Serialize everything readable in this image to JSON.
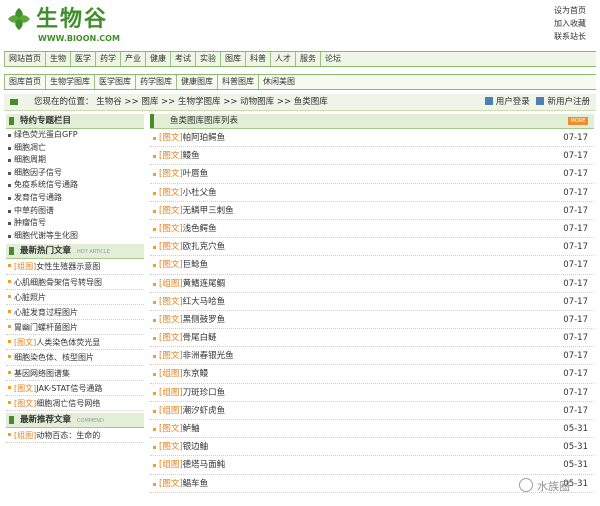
{
  "header": {
    "logo_name": "生物谷",
    "logo_domain": "WWW.BIOON.COM",
    "links": [
      "设为首页",
      "加入收藏",
      "联系站长"
    ]
  },
  "nav_main": [
    "网站首页",
    "生物",
    "医学",
    "药学",
    "产业",
    "健康",
    "考试",
    "实验",
    "图库",
    "科普",
    "人才",
    "服务",
    "论坛"
  ],
  "nav_sub": [
    "图库首页",
    "生物学图库",
    "医学图库",
    "药学图库",
    "健康图库",
    "科普图库",
    "休闲美图"
  ],
  "breadcrumb": {
    "path": "您现在的位置： 生物谷 >> 图库 >> 生物学图库 >> 动物图库 >> 鱼类图库",
    "login": "用户登录",
    "register": "新用户注册"
  },
  "left": {
    "section1": {
      "title": "特约专题栏目",
      "items": [
        "绿色荧光蛋白GFP",
        "细胞凋亡",
        "细胞周期",
        "细胞因子信号",
        "免疫系统信号通路",
        "发育信号通路",
        "中草药图谱",
        "肿瘤信号",
        "细胞代谢等生化图"
      ]
    },
    "section2": {
      "title": "最新热门文章",
      "sub": "HOT ARTICLE",
      "items": [
        {
          "tag": "[组图]",
          "text": "女性生殖器示意图"
        },
        {
          "tag": "",
          "text": "心肌细胞骨架信号转导图"
        },
        {
          "tag": "",
          "text": "心脏照片"
        },
        {
          "tag": "",
          "text": "心脏发育过程图片"
        },
        {
          "tag": "",
          "text": "胃幽门螺杆菌图片"
        },
        {
          "tag": "[图文]",
          "text": "人类染色体荧光显"
        },
        {
          "tag": "",
          "text": "细胞染色体、核型图片"
        },
        {
          "tag": "",
          "text": "基因网络图谱集"
        },
        {
          "tag": "[图文]",
          "text": "JAK-STAT信号通路"
        },
        {
          "tag": "[图文]",
          "text": "细胞凋亡信号网络"
        }
      ]
    },
    "section3": {
      "title": "最新推荐文章",
      "sub": "COMMEND",
      "items": [
        {
          "tag": "[组图]",
          "text": "动物百态：生命的"
        }
      ]
    }
  },
  "right": {
    "title": "鱼类图库图库列表",
    "more_label": "MORE",
    "rows": [
      {
        "tag": "[图文]",
        "title": "帕阿珀鳄鱼",
        "date": "07-17"
      },
      {
        "tag": "[图文]",
        "title": "鳗鱼",
        "date": "07-17"
      },
      {
        "tag": "[图文]",
        "title": "叶唇鱼",
        "date": "07-17"
      },
      {
        "tag": "[图文]",
        "title": "小杜父鱼",
        "date": "07-17"
      },
      {
        "tag": "[图文]",
        "title": "无鳞甲三刺鱼",
        "date": "07-17"
      },
      {
        "tag": "[图文]",
        "title": "浅色鳄鱼",
        "date": "07-17"
      },
      {
        "tag": "[图文]",
        "title": "欧扎克穴鱼",
        "date": "07-17"
      },
      {
        "tag": "[图文]",
        "title": "巨鲶鱼",
        "date": "07-17"
      },
      {
        "tag": "[组图]",
        "title": "黄鳍连尾鲷",
        "date": "07-17"
      },
      {
        "tag": "[图文]",
        "title": "红大马哈鱼",
        "date": "07-17"
      },
      {
        "tag": "[图文]",
        "title": "黑侧鼓罗鱼",
        "date": "07-17"
      },
      {
        "tag": "[图文]",
        "title": "骨尾白鲢",
        "date": "07-17"
      },
      {
        "tag": "[图文]",
        "title": "非洲春银光鱼",
        "date": "07-17"
      },
      {
        "tag": "[组图]",
        "title": "东京鳗",
        "date": "07-17"
      },
      {
        "tag": "[组图]",
        "title": "刀斑珍口鱼",
        "date": "07-17"
      },
      {
        "tag": "[组图]",
        "title": "潮汐虾虎鱼",
        "date": "07-17"
      },
      {
        "tag": "[图文]",
        "title": "鲈鲉",
        "date": "05-31"
      },
      {
        "tag": "[图文]",
        "title": "银边鲉",
        "date": "05-31"
      },
      {
        "tag": "[组图]",
        "title": "德塔马面鲀",
        "date": "05-31"
      },
      {
        "tag": "[图文]",
        "title": "鲳车鱼",
        "date": "05-31"
      }
    ]
  },
  "watermark": "水族圈",
  "colors": {
    "brand_green": "#3f8f2a",
    "tag_orange": "#e4811c",
    "header_bg": "#e2efd6"
  }
}
